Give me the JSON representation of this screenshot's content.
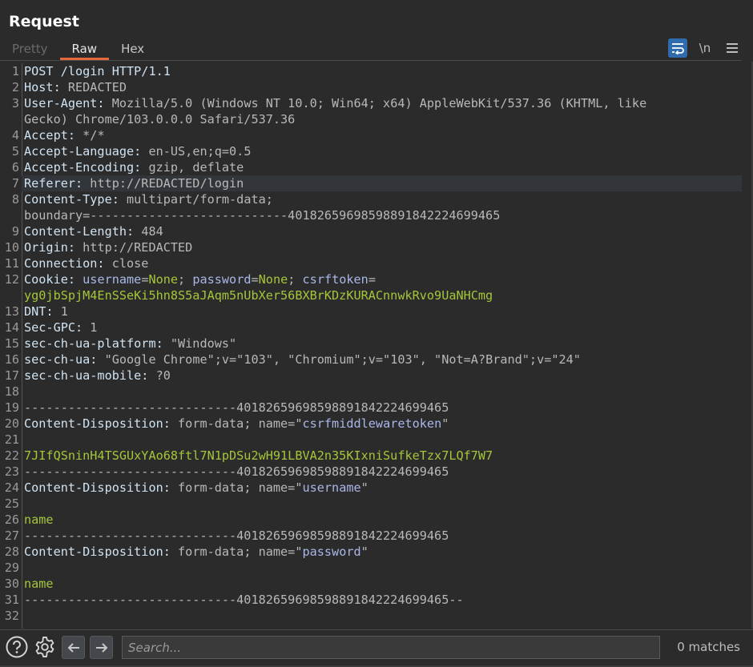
{
  "panel": {
    "title": "Request"
  },
  "tabs": [
    {
      "label": "Pretty",
      "state": "disabled"
    },
    {
      "label": "Raw",
      "state": "active"
    },
    {
      "label": "Hex",
      "state": "normal"
    }
  ],
  "toolbar": {
    "wrap_icon": "wrap-lines-icon",
    "newline_label": "\\n",
    "menu_icon": "hamburger-menu-icon"
  },
  "editor": {
    "highlighted_line": 7,
    "lines": [
      {
        "n": "1",
        "segments": [
          [
            "hn",
            "POST /login HTTP/1.1"
          ]
        ]
      },
      {
        "n": "2",
        "segments": [
          [
            "hn",
            "Host: "
          ],
          [
            "hv",
            "REDACTED"
          ]
        ]
      },
      {
        "n": "3",
        "segments": [
          [
            "hn",
            "User-Agent: "
          ],
          [
            "hv",
            "Mozilla/5.0 (Windows NT 10.0; Win64; x64) AppleWebKit/537.36 (KHTML, like"
          ]
        ]
      },
      {
        "n": "",
        "segments": [
          [
            "hv",
            "Gecko) Chrome/103.0.0.0 Safari/537.36"
          ]
        ]
      },
      {
        "n": "4",
        "segments": [
          [
            "hn",
            "Accept: "
          ],
          [
            "hv",
            "*/*"
          ]
        ]
      },
      {
        "n": "5",
        "segments": [
          [
            "hn",
            "Accept-Language: "
          ],
          [
            "hv",
            "en-US,en;q=0.5"
          ]
        ]
      },
      {
        "n": "6",
        "segments": [
          [
            "hn",
            "Accept-Encoding: "
          ],
          [
            "hv",
            "gzip, deflate"
          ]
        ]
      },
      {
        "n": "7",
        "segments": [
          [
            "hn",
            "Referer: "
          ],
          [
            "hv",
            "http://REDACTED/login"
          ]
        ]
      },
      {
        "n": "8",
        "segments": [
          [
            "hn",
            "Content-Type: "
          ],
          [
            "hv",
            "multipart/form-data;"
          ]
        ]
      },
      {
        "n": "",
        "segments": [
          [
            "hv",
            "boundary=---------------------------401826596985988918422246994 65"
          ]
        ]
      },
      {
        "n": "9",
        "segments": [
          [
            "hn",
            "Content-Length: "
          ],
          [
            "hv",
            "484"
          ]
        ]
      },
      {
        "n": "10",
        "segments": [
          [
            "hn",
            "Origin: "
          ],
          [
            "hv",
            "http://REDACTED"
          ]
        ]
      },
      {
        "n": "11",
        "segments": [
          [
            "hn",
            "Connection: "
          ],
          [
            "hv",
            "close"
          ]
        ]
      },
      {
        "n": "12",
        "segments": [
          [
            "hn",
            "Cookie: "
          ],
          [
            "qs",
            "username"
          ],
          [
            "hv",
            "="
          ],
          [
            "pv",
            "None"
          ],
          [
            "hv",
            "; "
          ],
          [
            "qs",
            "password"
          ],
          [
            "hv",
            "="
          ],
          [
            "pv",
            "None"
          ],
          [
            "hv",
            "; "
          ],
          [
            "qs",
            "csrftoken"
          ],
          [
            "hv",
            "="
          ]
        ]
      },
      {
        "n": "",
        "segments": [
          [
            "pv",
            "yg0jbSpjM4EnSSeKi5hn8S5aJAqm5nUbXer56BXBrKDzKURACnnwkRvo9UaNHCmg"
          ]
        ]
      },
      {
        "n": "13",
        "segments": [
          [
            "hn",
            "DNT: "
          ],
          [
            "hv",
            "1"
          ]
        ]
      },
      {
        "n": "14",
        "segments": [
          [
            "hn",
            "Sec-GPC: "
          ],
          [
            "hv",
            "1"
          ]
        ]
      },
      {
        "n": "15",
        "segments": [
          [
            "hn",
            "sec-ch-ua-platform: "
          ],
          [
            "hv",
            "\"Windows\""
          ]
        ]
      },
      {
        "n": "16",
        "segments": [
          [
            "hn",
            "sec-ch-ua: "
          ],
          [
            "hv",
            "\"Google Chrome\";v=\"103\", \"Chromium\";v=\"103\", \"Not=A?Brand\";v=\"24\""
          ]
        ]
      },
      {
        "n": "17",
        "segments": [
          [
            "hn",
            "sec-ch-ua-mobile: "
          ],
          [
            "hv",
            "?0"
          ]
        ]
      },
      {
        "n": "18",
        "segments": []
      },
      {
        "n": "19",
        "segments": [
          [
            "bd",
            "-----------------------------401826596985988918422246994 65"
          ]
        ]
      },
      {
        "n": "20",
        "segments": [
          [
            "hn",
            "Content-Disposition: "
          ],
          [
            "hv",
            "form-data; name=\""
          ],
          [
            "qs",
            "csrfmiddlewaretoken"
          ],
          [
            "hv",
            "\""
          ]
        ]
      },
      {
        "n": "21",
        "segments": []
      },
      {
        "n": "22",
        "segments": [
          [
            "pv",
            "7JIfQSninH4TSGUxYAo68ftl7N1pDSu2wH91LBVA2n35KIxniSufkeTzx7LQf7W7"
          ]
        ]
      },
      {
        "n": "23",
        "segments": [
          [
            "bd",
            "-----------------------------401826596985988918422246994 65"
          ]
        ]
      },
      {
        "n": "24",
        "segments": [
          [
            "hn",
            "Content-Disposition: "
          ],
          [
            "hv",
            "form-data; name=\""
          ],
          [
            "qs",
            "username"
          ],
          [
            "hv",
            "\""
          ]
        ]
      },
      {
        "n": "25",
        "segments": []
      },
      {
        "n": "26",
        "segments": [
          [
            "pv",
            "name"
          ]
        ]
      },
      {
        "n": "27",
        "segments": [
          [
            "bd",
            "-----------------------------401826596985988918422246994 65"
          ]
        ]
      },
      {
        "n": "28",
        "segments": [
          [
            "hn",
            "Content-Disposition: "
          ],
          [
            "hv",
            "form-data; name=\""
          ],
          [
            "qs",
            "password"
          ],
          [
            "hv",
            "\""
          ]
        ]
      },
      {
        "n": "29",
        "segments": []
      },
      {
        "n": "30",
        "segments": [
          [
            "pv",
            "name"
          ]
        ]
      },
      {
        "n": "31",
        "segments": [
          [
            "bd",
            "-----------------------------401826596985988918422246994 65--"
          ]
        ]
      },
      {
        "n": "32",
        "segments": []
      }
    ]
  },
  "bottom": {
    "help_icon": "help-icon",
    "settings_icon": "gear-icon",
    "prev_icon": "arrow-left-icon",
    "next_icon": "arrow-right-icon",
    "search_placeholder": "Search...",
    "search_value": "",
    "matches": "0 matches"
  },
  "colors": {
    "accent_tab_underline": "#e3683a",
    "toggle_active": "#2f6bad",
    "header_name": "#cfe3f3",
    "header_value": "#b8b8b8",
    "param_value": "#a4c639",
    "quoted_name": "#a9b7e8"
  }
}
